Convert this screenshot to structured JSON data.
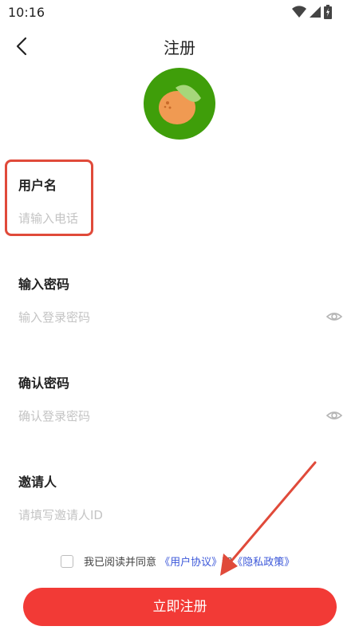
{
  "status_bar": {
    "time": "10:16"
  },
  "header": {
    "title": "注册"
  },
  "form": {
    "username": {
      "label": "用户名",
      "placeholder": "请输入电话"
    },
    "password": {
      "label": "输入密码",
      "placeholder": "输入登录密码"
    },
    "confirm": {
      "label": "确认密码",
      "placeholder": "确认登录密码"
    },
    "inviter": {
      "label": "邀请人",
      "placeholder": "请填写邀请人ID"
    }
  },
  "agreement": {
    "prefix": "我已阅读并同意",
    "user_agreement": "《用户协议》",
    "and": "和",
    "privacy_policy": "《隐私政策》"
  },
  "submit_label": "立即注册",
  "colors": {
    "accent": "#f23a36",
    "link": "#3b57d9",
    "logo_bg": "#3f9e0a",
    "annotation": "#e04a3a"
  }
}
